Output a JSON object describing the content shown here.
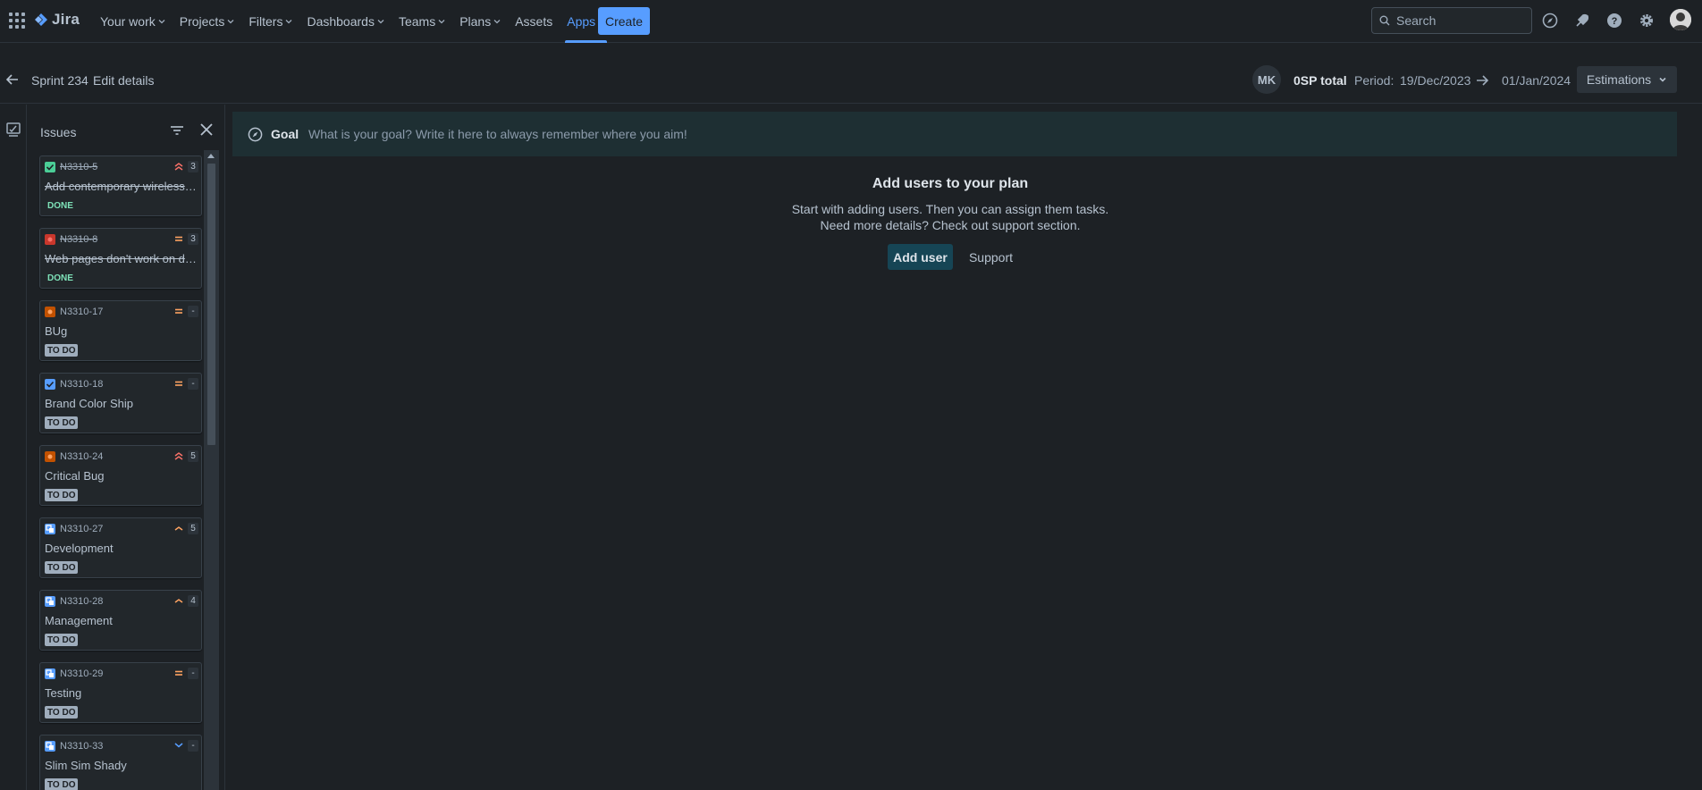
{
  "app": {
    "name": "Jira"
  },
  "nav": {
    "items": [
      {
        "label": "Your work",
        "dropdown": true
      },
      {
        "label": "Projects",
        "dropdown": true
      },
      {
        "label": "Filters",
        "dropdown": true
      },
      {
        "label": "Dashboards",
        "dropdown": true
      },
      {
        "label": "Teams",
        "dropdown": true
      },
      {
        "label": "Plans",
        "dropdown": true
      },
      {
        "label": "Assets",
        "dropdown": false
      },
      {
        "label": "Apps",
        "dropdown": true,
        "active": true
      }
    ],
    "create_label": "Create",
    "search_placeholder": "Search"
  },
  "sprint": {
    "name": "Sprint 234",
    "edit_label": "Edit details",
    "avatar_initials": "MK",
    "total_label": "0SP total",
    "period_label": "Period:",
    "period_start": "19/Dec/2023",
    "period_end": "01/Jan/2024",
    "estimations_label": "Estimations"
  },
  "issues_panel": {
    "title": "Issues",
    "issues": [
      {
        "key": "N3310-5",
        "title": "Add contemporary wireless technology",
        "status": "DONE",
        "done": true,
        "type": "story-done",
        "priority": "highest",
        "estimate": "3"
      },
      {
        "key": "N3310-8",
        "title": "Web pages don't work on devices",
        "status": "DONE",
        "done": true,
        "type": "bug",
        "priority": "medium",
        "estimate": "3"
      },
      {
        "key": "N3310-17",
        "title": "BUg",
        "status": "TO DO",
        "done": false,
        "type": "bug-orange",
        "priority": "medium",
        "estimate": "-"
      },
      {
        "key": "N3310-18",
        "title": "Brand Color Ship",
        "status": "TO DO",
        "done": false,
        "type": "task",
        "priority": "medium",
        "estimate": "-"
      },
      {
        "key": "N3310-24",
        "title": "Critical Bug",
        "status": "TO DO",
        "done": false,
        "type": "bug-orange",
        "priority": "highest",
        "estimate": "5"
      },
      {
        "key": "N3310-27",
        "title": "Development",
        "status": "TO DO",
        "done": false,
        "type": "subtask",
        "priority": "high",
        "estimate": "5"
      },
      {
        "key": "N3310-28",
        "title": "Management",
        "status": "TO DO",
        "done": false,
        "type": "subtask",
        "priority": "high",
        "estimate": "4"
      },
      {
        "key": "N3310-29",
        "title": "Testing",
        "status": "TO DO",
        "done": false,
        "type": "subtask",
        "priority": "medium",
        "estimate": "-"
      },
      {
        "key": "N3310-33",
        "title": "Slim Sim Shady",
        "status": "TO DO",
        "done": false,
        "type": "subtask",
        "priority": "low",
        "estimate": "-"
      }
    ]
  },
  "goal": {
    "label": "Goal",
    "placeholder": "What is your goal? Write it here to always remember where you aim!"
  },
  "empty_state": {
    "title": "Add users to your plan",
    "line1": "Start with adding users. Then you can assign them tasks.",
    "line2": "Need more details? Check out support section.",
    "add_user_label": "Add user",
    "support_label": "Support"
  },
  "colors": {
    "background": "#1d2125",
    "accent": "#579dff",
    "goal_bar": "#1e2f33",
    "add_user_button": "#164555"
  }
}
